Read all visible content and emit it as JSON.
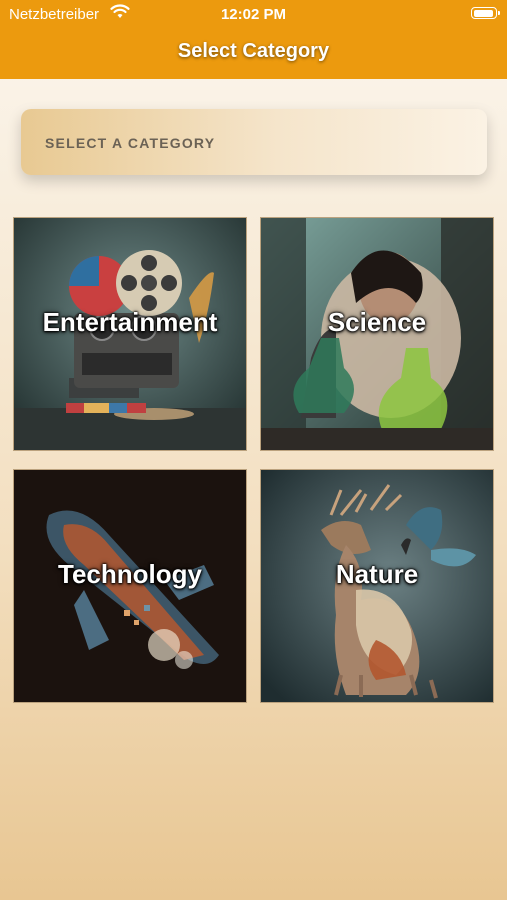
{
  "status_bar": {
    "carrier": "Netzbetreiber",
    "time": "12:02 PM"
  },
  "header": {
    "title": "Select Category"
  },
  "category_select": {
    "placeholder": "SELECT A CATEGORY"
  },
  "categories": [
    {
      "label": "Entertainment",
      "icon": "film-reel-projector-image"
    },
    {
      "label": "Science",
      "icon": "scientist-lab-image"
    },
    {
      "label": "Technology",
      "icon": "digital-rocket-image"
    },
    {
      "label": "Nature",
      "icon": "deer-butterfly-image"
    }
  ],
  "colors": {
    "header": "#ec9a0e",
    "background_top": "#fbf6ee",
    "background_bottom": "#e8c692"
  }
}
